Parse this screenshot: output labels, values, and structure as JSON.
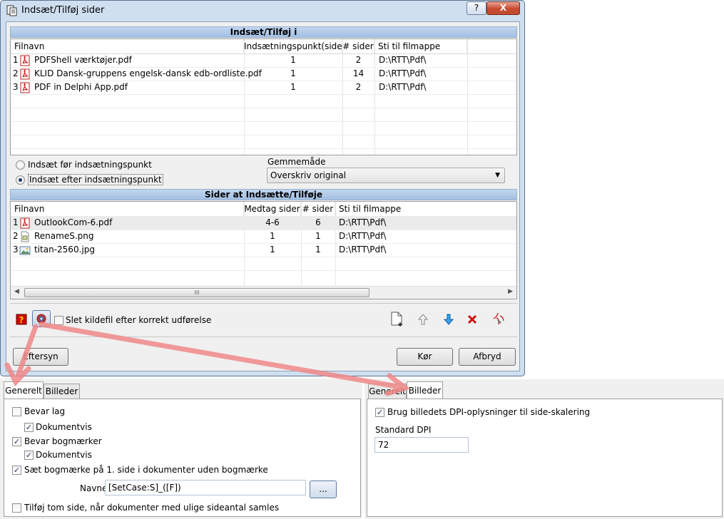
{
  "window": {
    "title": "Indsæt/Tilføj sider",
    "help": "?",
    "close": "X"
  },
  "top_section": {
    "header": "Indsæt/Tilføj i",
    "columns": [
      "Filnavn",
      "Indsætningspunkt(side)",
      "# sider",
      "Sti til filmappe"
    ],
    "rows": [
      {
        "num": "1",
        "name": "PDFShell værktøjer.pdf",
        "icon": "pdf-icon",
        "point": "1",
        "pages": "2",
        "path": "D:\\RTT\\Pdf\\"
      },
      {
        "num": "2",
        "name": "KLID Dansk-gruppens engelsk-dansk edb-ordliste.pdf",
        "icon": "pdf-icon",
        "point": "1",
        "pages": "14",
        "path": "D:\\RTT\\Pdf\\"
      },
      {
        "num": "3",
        "name": "PDF in Delphi App.pdf",
        "icon": "pdf-icon",
        "point": "1",
        "pages": "2",
        "path": "D:\\RTT\\Pdf\\"
      }
    ]
  },
  "options": {
    "radio_before": "Indsæt før indsætningspunkt",
    "radio_after": "Indsæt efter indsætningspunkt",
    "selected": "after",
    "save_mode_label": "Gemmemåde",
    "save_mode_value": "Overskriv original"
  },
  "bottom_section": {
    "header": "Sider at Indsætte/Tilføje",
    "columns": [
      "Filnavn",
      "Medtag sider",
      "# sider",
      "Sti til filmappe"
    ],
    "rows": [
      {
        "num": "1",
        "name": "OutlookCom-6.pdf",
        "icon": "pdf-icon",
        "include": "4-6",
        "pages": "6",
        "path": "D:\\RTT\\Pdf\\"
      },
      {
        "num": "2",
        "name": "RenameS.png",
        "icon": "image-file-icon",
        "include": "1",
        "pages": "1",
        "path": "D:\\RTT\\Pdf\\"
      },
      {
        "num": "3",
        "name": "titan-2560.jpg",
        "icon": "photo-icon",
        "include": "1",
        "pages": "1",
        "path": "D:\\RTT\\Pdf\\"
      }
    ],
    "scroll_grip": "III"
  },
  "toolbar": {
    "delete_source": "Slet kildefil efter korrekt udførelse",
    "delete_source_checked": false,
    "icons": [
      "help-book-icon",
      "settings-gear-icon",
      "add-file-icon",
      "move-up-icon",
      "move-down-icon",
      "delete-icon",
      "clear-icon"
    ]
  },
  "buttons": {
    "preview": "Eftersyn",
    "run": "Kør",
    "cancel": "Afbryd"
  },
  "general_panel": {
    "tabs": [
      "Generelt",
      "Billeder"
    ],
    "active_tab": "Generelt",
    "keep_layers": "Bevar lag",
    "keep_layers_checked": false,
    "doc_layers": "Dokumentvis",
    "doc_layers_checked": true,
    "keep_bookmarks": "Bevar bogmærker",
    "keep_bookmarks_checked": true,
    "doc_bookmarks": "Dokumentvis",
    "doc_bookmarks_checked": true,
    "set_bookmark": "Sæt bogmærke på 1. side i dokumenter uden bogmærke",
    "set_bookmark_checked": true,
    "name_label": "Navne",
    "name_value": "[SetCase:S]_([F])",
    "browse": "...",
    "add_blank": "Tilføj tom side, når dokumenter med ulige sideantal samles",
    "add_blank_checked": false
  },
  "images_panel": {
    "tabs": [
      "Generelt",
      "Billeder"
    ],
    "active_tab": "Billeder",
    "use_dpi": "Brug billedets DPI-oplysninger til side-skalering",
    "use_dpi_checked": true,
    "std_dpi_label": "Standard DPI",
    "std_dpi_value": "72"
  },
  "checkmark": "✓",
  "colors": {
    "arrow": "#f08080",
    "header_blue": "#a3bfe2",
    "close_red": "#c74a30"
  }
}
